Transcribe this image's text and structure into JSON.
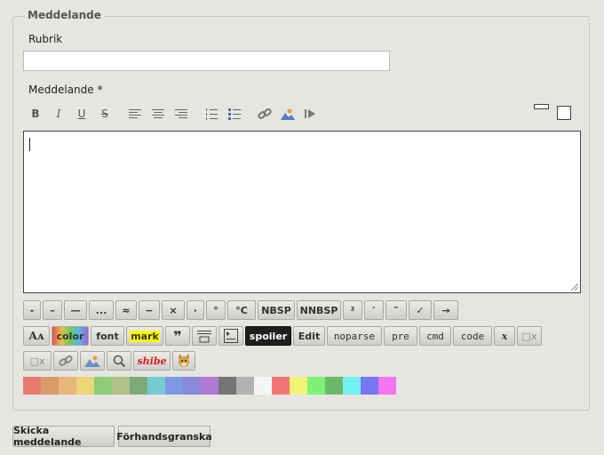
{
  "form": {
    "legend": "Meddelande",
    "subject_label": "Rubrik",
    "subject_value": "",
    "message_label": "Meddelande *",
    "message_value": ""
  },
  "toolbar": {
    "bold": "B",
    "italic": "I",
    "underline": "U",
    "strike": "S"
  },
  "chars": [
    "-",
    "–",
    "—",
    "...",
    "≈",
    "−",
    "×",
    "·",
    "°",
    "°C",
    "NBSP",
    "NNBSP",
    "²",
    "′",
    "″",
    "✓",
    "→"
  ],
  "bbcode": {
    "size": "Aᴀ",
    "color": "color",
    "font": "font",
    "mark": "mark",
    "quote": "❞",
    "spoiler": "spoiler",
    "edit": "Edit",
    "noparse": "noparse",
    "pre": "pre",
    "cmd": "cmd",
    "code": "code",
    "math": "x",
    "sub": "□x",
    "sup": "□x",
    "shibe": "shibe"
  },
  "colors": {
    "swatches": [
      "#e87a72",
      "#da9a6c",
      "#eab77a",
      "#ecd676",
      "#8fcc7a",
      "#b2c08a",
      "#7eaa78",
      "#74ccd2",
      "#7f98e4",
      "#8a8adc",
      "#b07ad4",
      "#747474",
      "#b2b2b2",
      "#f5f5f5",
      "#f27676",
      "#f2f276",
      "#7ef276",
      "#6cb86a",
      "#74f2f2",
      "#7676f2",
      "#f276f2"
    ]
  },
  "actions": {
    "send": "Skicka meddelande",
    "preview": "Förhandsgranska"
  }
}
